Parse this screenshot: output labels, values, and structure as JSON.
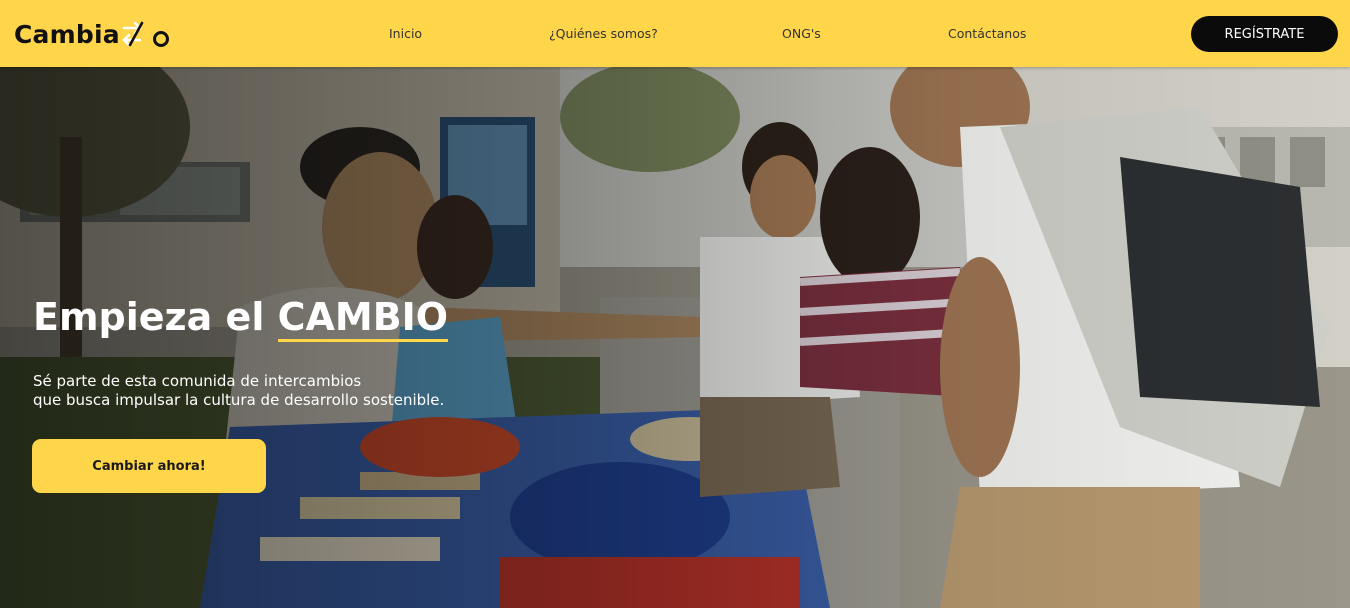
{
  "brand": {
    "name": "Cambia",
    "logo_icon": "exchange-arrows-icon",
    "accent": "#ffd54a",
    "dark": "#0b0b0b"
  },
  "nav": {
    "links": [
      "Inicio",
      "¿Quiénes somos?",
      "ONG's",
      "Contáctanos"
    ],
    "register_label": "REGÍSTRATE"
  },
  "hero": {
    "title_lead": "Empieza el ",
    "title_accent": "CAMBIO",
    "subtitle_line1": "Sé parte de esta comunida de intercambios",
    "subtitle_line2": "que busca impulsar la cultura de desarrollo sostenible.",
    "cta_label": "Cambiar ahora!"
  }
}
